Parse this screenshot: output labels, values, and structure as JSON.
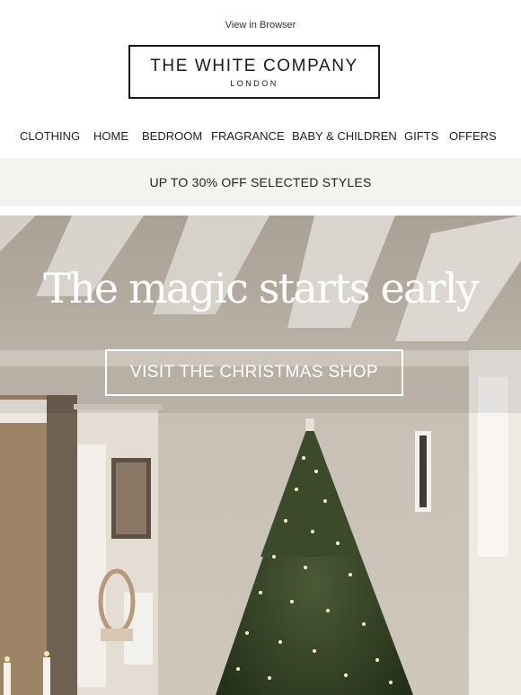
{
  "header": {
    "view_in_browser": "View in Browser",
    "logo_main": "THE WHITE COMPANY",
    "logo_sub": "LONDON"
  },
  "nav": {
    "items": [
      {
        "label": "CLOTHING"
      },
      {
        "label": "HOME"
      },
      {
        "label": "BEDROOM"
      },
      {
        "label": "FRAGRANCE"
      },
      {
        "label": "BABY & CHILDREN"
      },
      {
        "label": "GIFTS"
      },
      {
        "label": "OFFERS"
      }
    ]
  },
  "promo": {
    "text": "UP TO 30% OFF SELECTED STYLES"
  },
  "hero": {
    "headline": "The magic starts early",
    "cta_label": "VISIT THE CHRISTMAS SHOP"
  },
  "colors": {
    "text": "#222222",
    "promo_background": "#f4f3ef",
    "hero_text": "#ffffff",
    "tree_green": "#2f3b24"
  }
}
